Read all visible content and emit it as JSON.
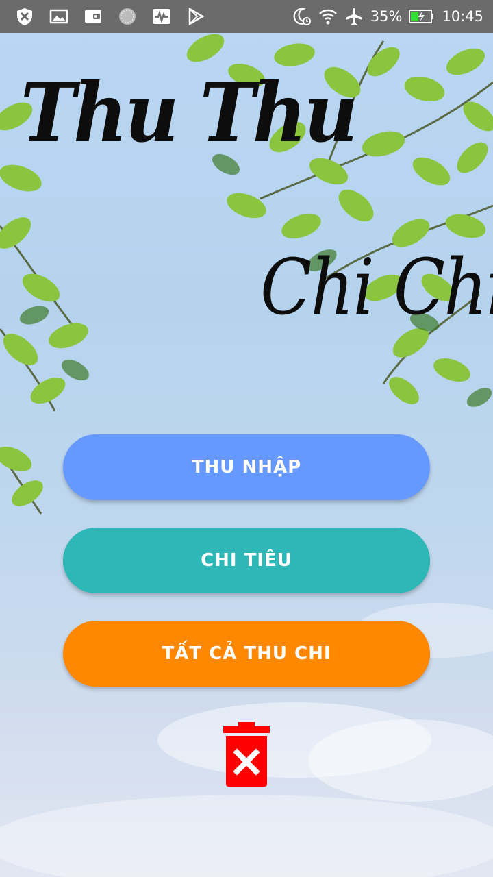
{
  "status_bar": {
    "battery_percent": "35%",
    "time": "10:45",
    "icons": [
      "shield-icon",
      "image-icon",
      "wallet-icon",
      "circle-icon",
      "pulse-icon",
      "play-store-icon",
      "moon-alarm-icon",
      "wifi-icon",
      "airplane-icon",
      "battery-icon"
    ]
  },
  "header": {
    "title_line_1": "Thu Thu",
    "title_line_2": "Chi Chi"
  },
  "menu": {
    "income_label": "THU NHẬP",
    "expense_label": "CHI TIÊU",
    "all_label": "TẤT CẢ THU CHI"
  },
  "actions": {
    "delete_icon": "trash-x-icon"
  },
  "colors": {
    "income": "#6699ff",
    "expense": "#2db7b7",
    "all": "#ff8800",
    "delete": "#ff0000",
    "status_bar": "#6b6b6b"
  }
}
